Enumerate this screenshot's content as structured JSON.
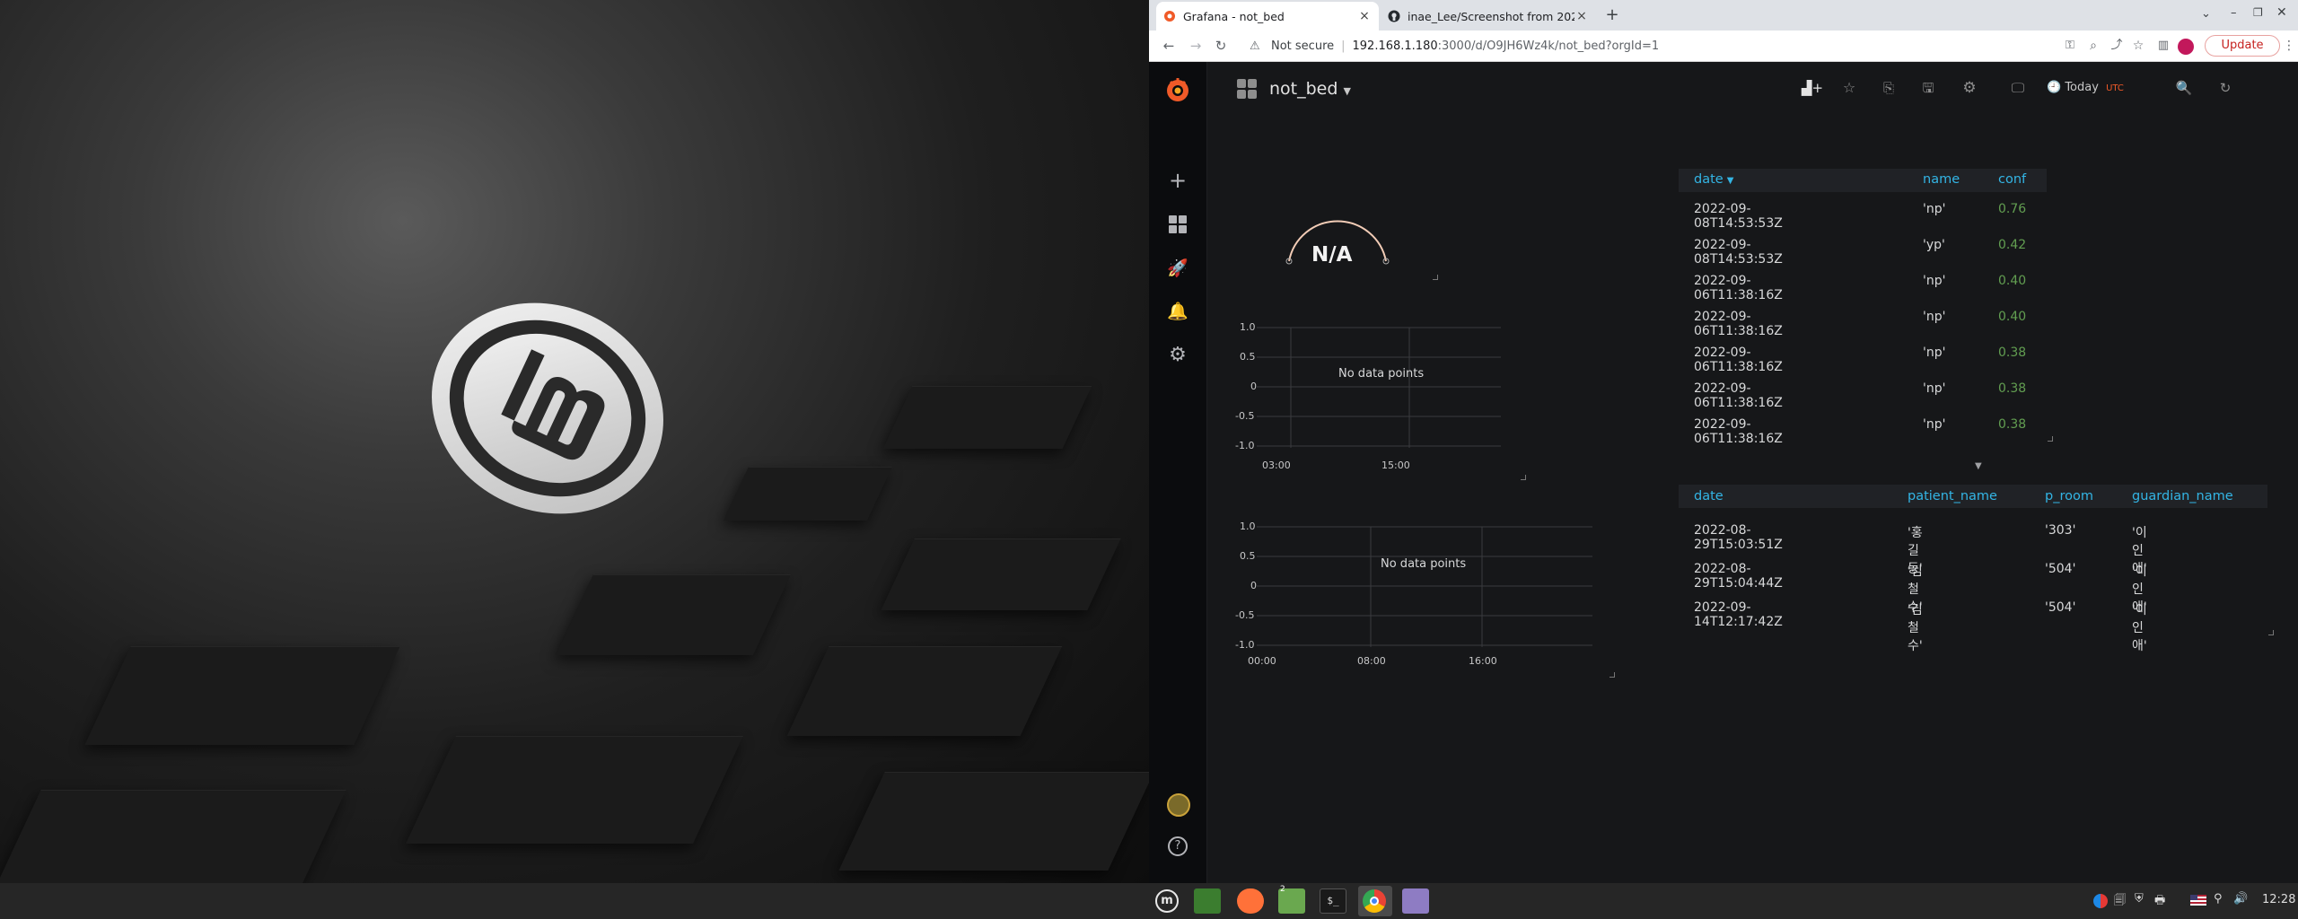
{
  "browser": {
    "tabs": [
      {
        "title": "Grafana - not_bed",
        "active": true,
        "icon": "grafana-icon"
      },
      {
        "title": "inae_Lee/Screenshot from 202",
        "active": false,
        "icon": "github-icon"
      }
    ],
    "new_tab": "+",
    "address": {
      "security": "Not secure",
      "url_host": "192.168.1.180",
      "url_rest": ":3000/d/O9JH6Wz4k/not_bed?orgId=1"
    },
    "update_label": "Update"
  },
  "dashboard": {
    "title": "not_bed",
    "time_picker": {
      "label": "Today",
      "tz": "UTC"
    },
    "gauge": {
      "value": "N/A"
    },
    "graph1": {
      "y_ticks": [
        "1.0",
        "0.5",
        "0",
        "-0.5",
        "-1.0"
      ],
      "x_ticks": [
        "03:00",
        "15:00"
      ],
      "message": "No data points"
    },
    "graph2": {
      "y_ticks": [
        "1.0",
        "0.5",
        "0",
        "-0.5",
        "-1.0"
      ],
      "x_ticks": [
        "00:00",
        "08:00",
        "16:00"
      ],
      "message": "No data points"
    },
    "table1": {
      "headers": [
        "date",
        "name",
        "conf"
      ],
      "rows": [
        [
          "2022-09-08T14:53:53Z",
          "'np'",
          "0.76"
        ],
        [
          "2022-09-08T14:53:53Z",
          "'yp'",
          "0.42"
        ],
        [
          "2022-09-06T11:38:16Z",
          "'np'",
          "0.40"
        ],
        [
          "2022-09-06T11:38:16Z",
          "'np'",
          "0.40"
        ],
        [
          "2022-09-06T11:38:16Z",
          "'np'",
          "0.38"
        ],
        [
          "2022-09-06T11:38:16Z",
          "'np'",
          "0.38"
        ],
        [
          "2022-09-06T11:38:16Z",
          "'np'",
          "0.38"
        ]
      ]
    },
    "table2": {
      "headers": [
        "date",
        "patient_name",
        "p_room",
        "guardian_name"
      ],
      "rows": [
        [
          "2022-08-29T15:03:51Z",
          "'홍길동'",
          "'303'",
          "'이인애'"
        ],
        [
          "2022-08-29T15:04:44Z",
          "'김철수'",
          "'504'",
          "'이인애'"
        ],
        [
          "2022-09-14T12:17:42Z",
          "'김철수'",
          "'504'",
          "'이인애'"
        ]
      ]
    }
  },
  "taskbar": {
    "clock": "12:28",
    "workspace_badge": "2"
  },
  "colors": {
    "grafana_orange": "#f05a28",
    "table_header_blue": "#33b5e5",
    "conf_green": "#629e51",
    "update_red": "#c5221f"
  }
}
